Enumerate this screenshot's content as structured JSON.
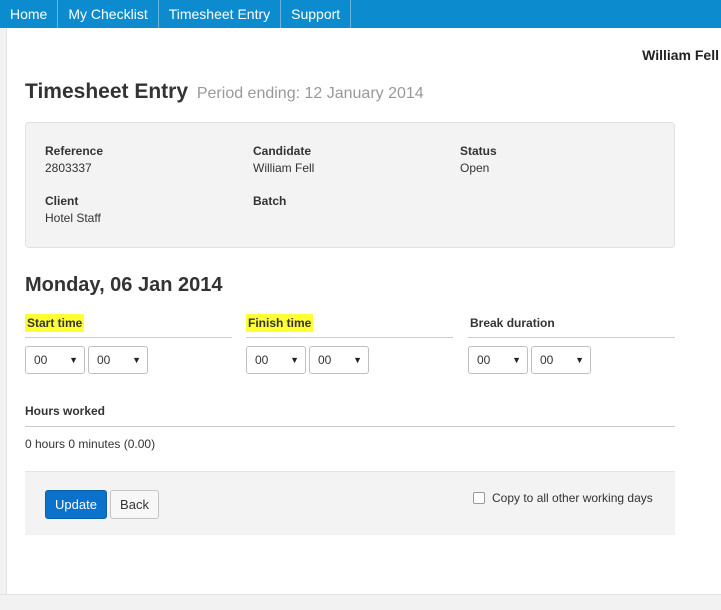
{
  "nav": {
    "items": [
      {
        "label": "Home"
      },
      {
        "label": "My Checklist"
      },
      {
        "label": "Timesheet Entry"
      },
      {
        "label": "Support"
      }
    ]
  },
  "user": {
    "name": "William Fell"
  },
  "page": {
    "title": "Timesheet Entry",
    "subtitle": "Period ending: 12 January 2014"
  },
  "info": {
    "reference_label": "Reference",
    "reference_value": "2803337",
    "candidate_label": "Candidate",
    "candidate_value": "William Fell",
    "status_label": "Status",
    "status_value": "Open",
    "client_label": "Client",
    "client_value": "Hotel Staff",
    "batch_label": "Batch",
    "batch_value": ""
  },
  "day": {
    "title": "Monday, 06 Jan 2014"
  },
  "times": {
    "start_label": "Start time",
    "start_hour": "00",
    "start_minute": "00",
    "finish_label": "Finish time",
    "finish_hour": "00",
    "finish_minute": "00",
    "break_label": "Break duration",
    "break_hour": "00",
    "break_minute": "00",
    "highlight_color": "#ffff33"
  },
  "hours": {
    "label": "Hours worked",
    "value": "0 hours 0 minutes (0.00)"
  },
  "actions": {
    "update_label": "Update",
    "back_label": "Back",
    "copy_label": "Copy to all other working days",
    "copy_checked": false
  },
  "colors": {
    "navbar": "#0c8ccf",
    "primary_button": "#0a72cc",
    "highlight": "#ffff33"
  }
}
